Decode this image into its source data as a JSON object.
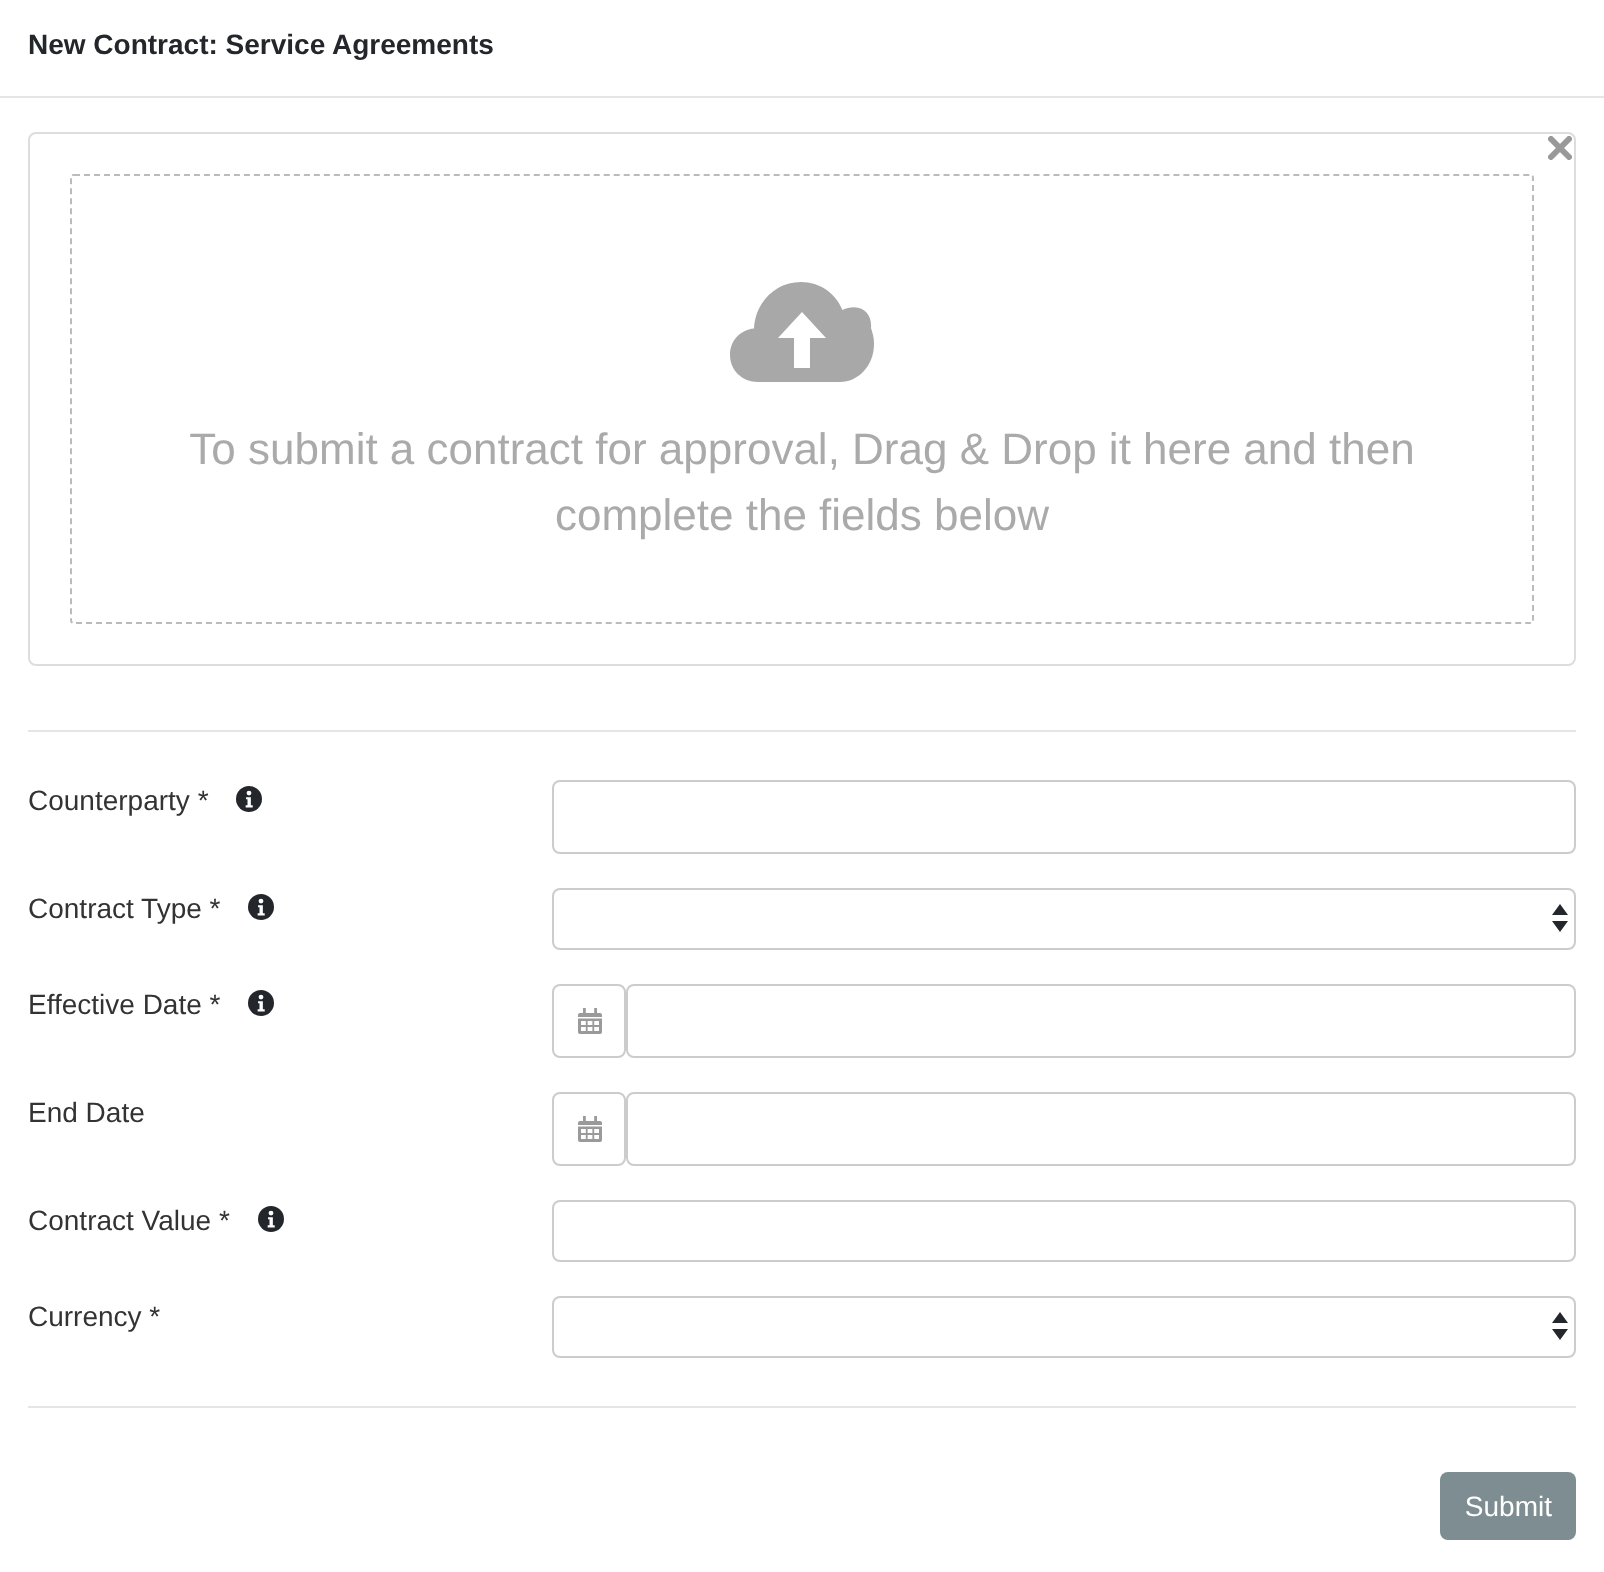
{
  "title": "New Contract: Service Agreements",
  "upload": {
    "message": "To submit a contract for approval, Drag & Drop it here and then complete the fields below",
    "closable": true
  },
  "fields": [
    {
      "label": "Counterparty *",
      "info": true,
      "kind": "lookup"
    },
    {
      "label": "Contract Type *",
      "info": true,
      "kind": "select"
    },
    {
      "label": "Effective Date *",
      "info": true,
      "kind": "date"
    },
    {
      "label": "End Date",
      "info": false,
      "kind": "date"
    },
    {
      "label": "Contract Value *",
      "info": true,
      "kind": "text"
    },
    {
      "label": "Currency *",
      "info": false,
      "kind": "select"
    }
  ],
  "submit": {
    "label": "Submit",
    "disabled": true
  }
}
